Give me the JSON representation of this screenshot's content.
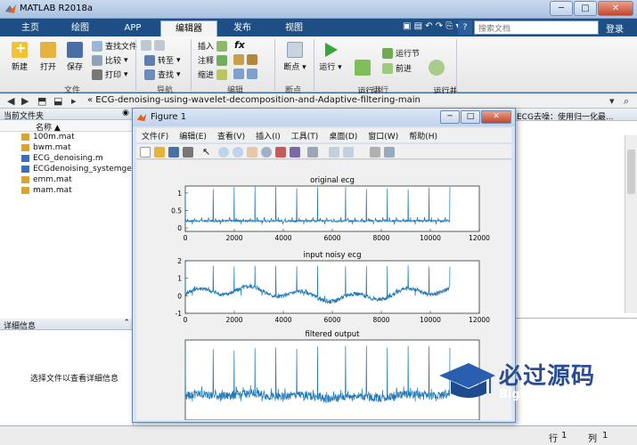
{
  "window": {
    "title": "MATLAB R2018a",
    "min": "─",
    "max": "□",
    "close": "✕"
  },
  "tabs": [
    "主页",
    "绘图",
    "APP",
    "编辑器",
    "发布",
    "视图"
  ],
  "search": {
    "placeholder": "搜索文档",
    "login": "登录"
  },
  "ribbon": {
    "file": {
      "new": "新建",
      "open": "打开",
      "save": "保存",
      "find_files": "查找文件",
      "compare": "比较",
      "print": "打印",
      "label": "文件"
    },
    "navigate": {
      "goto": "转至",
      "find": "查找",
      "label": "导航"
    },
    "edit": {
      "insert": "插入",
      "comment": "注释",
      "indent": "缩进",
      "fx": "fx",
      "label": "编辑"
    },
    "breakpoints": {
      "breakpoints": "断点",
      "label": "断点"
    },
    "run": {
      "run": "运行",
      "run_advance": "运行并\n前进",
      "run_section": "运行节",
      "advance": "前进",
      "run_time": "运行并\n计时",
      "label": "运行"
    }
  },
  "address": {
    "path": "« ECG-denoising-using-wavelet-decomposition-and-Adaptive-filtering-main"
  },
  "current_folder": {
    "title": "当前文件夹",
    "col_name": "名称 ▲",
    "files": [
      {
        "name": "100m.mat",
        "type": "mat"
      },
      {
        "name": "bwm.mat",
        "type": "mat"
      },
      {
        "name": "ECG_denoising.m",
        "type": "m"
      },
      {
        "name": "ECGdenoising_systemgen",
        "type": "m"
      },
      {
        "name": "emm.mat",
        "type": "mat"
      },
      {
        "name": "mam.mat",
        "type": "mat"
      }
    ]
  },
  "details": {
    "title": "详细信息",
    "hint": "选择文件以查看详细信息"
  },
  "command_panel": {
    "title": "ECG去噪：使用归一化最..."
  },
  "status": {
    "row_label": "行",
    "row_value": "1",
    "col_label": "列",
    "col_value": "1"
  },
  "figure": {
    "title": "Figure 1",
    "menus": [
      "文件(F)",
      "编辑(E)",
      "查看(V)",
      "插入(I)",
      "工具(T)",
      "桌面(D)",
      "窗口(W)",
      "帮助(H)"
    ]
  },
  "watermark": {
    "big": "必过源码",
    "small": "Biguo100.com"
  },
  "colors": {
    "signal": "#1f77b4",
    "accent": "#1d4f86"
  },
  "chart_data": [
    {
      "type": "line",
      "title": "original ecg",
      "xlim": [
        0,
        12000
      ],
      "ylim": [
        -0.1,
        1.2
      ],
      "xticks": [
        0,
        2000,
        4000,
        6000,
        8000,
        10000,
        12000
      ],
      "yticks": [
        0,
        0.5,
        1
      ],
      "series": [
        {
          "x_end": 10800,
          "baseline": 0.2,
          "peak": 1.15,
          "beats": 38,
          "noise": 0.03,
          "wander": 0.0
        }
      ]
    },
    {
      "type": "line",
      "title": "input noisy ecg",
      "xlim": [
        0,
        12000
      ],
      "ylim": [
        -1,
        2
      ],
      "xticks": [
        0,
        2000,
        4000,
        6000,
        8000,
        10000,
        12000
      ],
      "yticks": [
        -1,
        0,
        1,
        2
      ],
      "series": [
        {
          "x_end": 10800,
          "baseline": 0.1,
          "peak": 1.7,
          "beats": 38,
          "noise": 0.12,
          "wander": 0.45
        }
      ]
    },
    {
      "type": "line",
      "title": "filtered output",
      "xlim": [
        0,
        12000
      ],
      "ylim": [
        -0.2,
        1.3
      ],
      "xticks": [],
      "yticks": [],
      "series": [
        {
          "x_end": 10800,
          "baseline": 0.25,
          "peak": 1.15,
          "beats": 38,
          "noise": 0.08,
          "wander": 0.05
        }
      ]
    }
  ]
}
